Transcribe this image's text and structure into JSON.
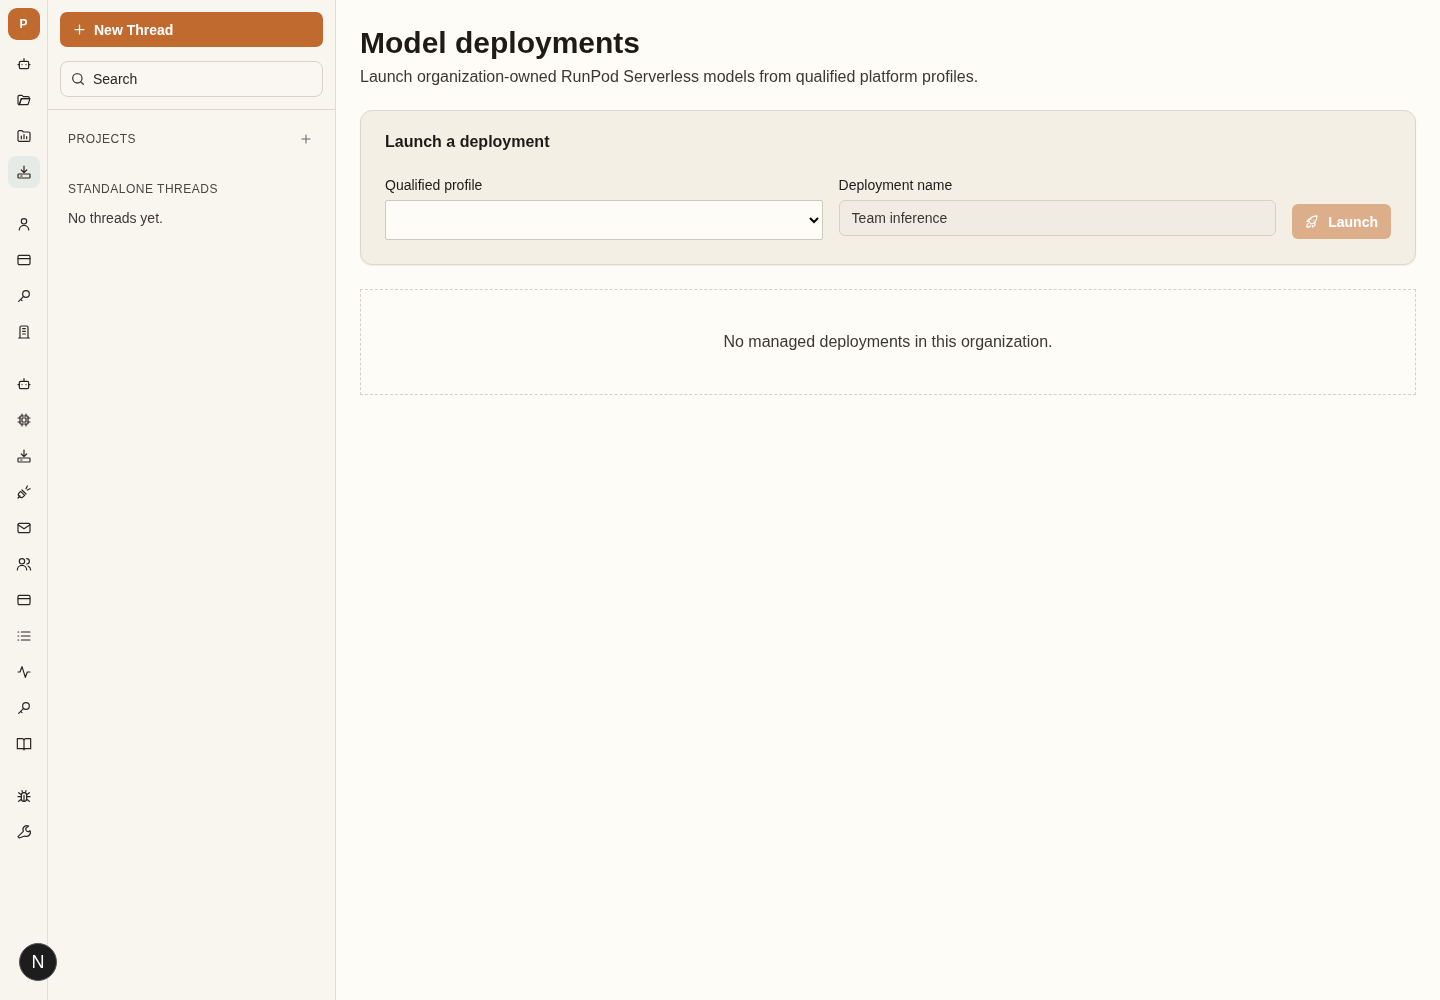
{
  "rail": {
    "avatar": "P",
    "groups": [
      [
        {
          "kind": "robot",
          "selected": false
        },
        {
          "kind": "folder",
          "selected": false
        },
        {
          "kind": "chart",
          "selected": false
        },
        {
          "kind": "tray",
          "selected": true
        }
      ],
      [
        {
          "kind": "user",
          "selected": false
        },
        {
          "kind": "card",
          "selected": false
        },
        {
          "kind": "key",
          "selected": false
        },
        {
          "kind": "building",
          "selected": false
        }
      ],
      [
        {
          "kind": "robot",
          "selected": false
        },
        {
          "kind": "chip",
          "selected": false
        },
        {
          "kind": "tray",
          "selected": false
        },
        {
          "kind": "plug",
          "selected": false
        },
        {
          "kind": "mail",
          "selected": false
        },
        {
          "kind": "users",
          "selected": false
        },
        {
          "kind": "card",
          "selected": false
        },
        {
          "kind": "list",
          "selected": false
        },
        {
          "kind": "activity",
          "selected": false
        },
        {
          "kind": "key",
          "selected": false
        },
        {
          "kind": "book",
          "selected": false
        }
      ],
      [
        {
          "kind": "bug",
          "selected": false
        },
        {
          "kind": "wrench",
          "selected": false
        }
      ]
    ],
    "dev_badge": "N"
  },
  "sidebar": {
    "new_button": "New Thread",
    "search": {
      "placeholder": "Search"
    },
    "projects_heading": "PROJECTS",
    "threads_heading": "STANDALONE THREADS",
    "empty": "No threads yet."
  },
  "main": {
    "title": "Model deployments",
    "subtitle": "Launch organization-owned RunPod Serverless models from qualified platform profiles.",
    "launch_card": {
      "title": "Launch a deployment",
      "profile_label": "Qualified profile",
      "name_label": "Deployment name",
      "name_value": "Team inference",
      "button": "Launch",
      "button_disabled": true
    },
    "empty_state": "No managed deployments in this organization."
  }
}
